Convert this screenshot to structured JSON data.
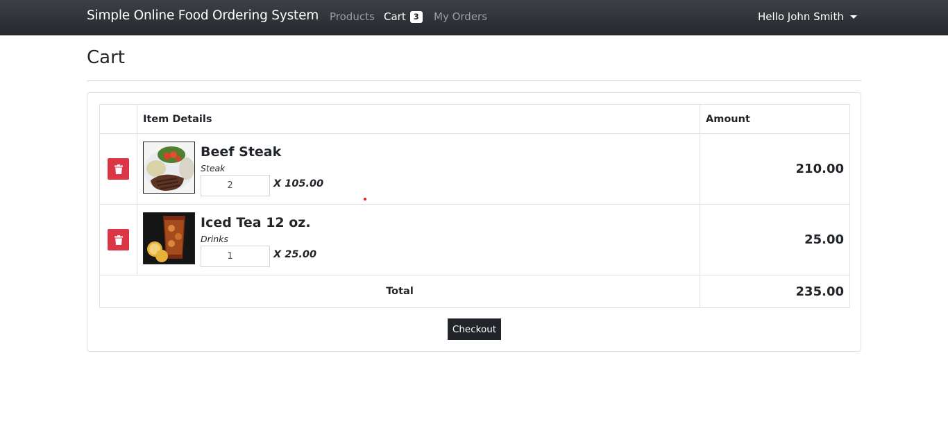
{
  "navbar": {
    "brand": "Simple Online Food Ordering System",
    "links": {
      "products": "Products",
      "cart": "Cart",
      "cart_count": "3",
      "my_orders": "My Orders"
    },
    "user_greeting": "Hello John Smith"
  },
  "page": {
    "title": "Cart"
  },
  "cart": {
    "columns": {
      "item_details": "Item Details",
      "amount": "Amount"
    },
    "items": [
      {
        "name": "Beef Steak",
        "category": "Steak",
        "quantity": "2",
        "unit_price": "X 105.00",
        "amount": "210.00",
        "image": "beef-steak-photo"
      },
      {
        "name": "Iced Tea 12 oz.",
        "category": "Drinks",
        "quantity": "1",
        "unit_price": "X 25.00",
        "amount": "25.00",
        "image": "iced-tea-photo"
      }
    ],
    "total_label": "Total",
    "total_amount": "235.00",
    "checkout_label": "Checkout"
  },
  "colors": {
    "navbar": "#343a40",
    "danger": "#dc3545",
    "dark_button": "#212529"
  }
}
